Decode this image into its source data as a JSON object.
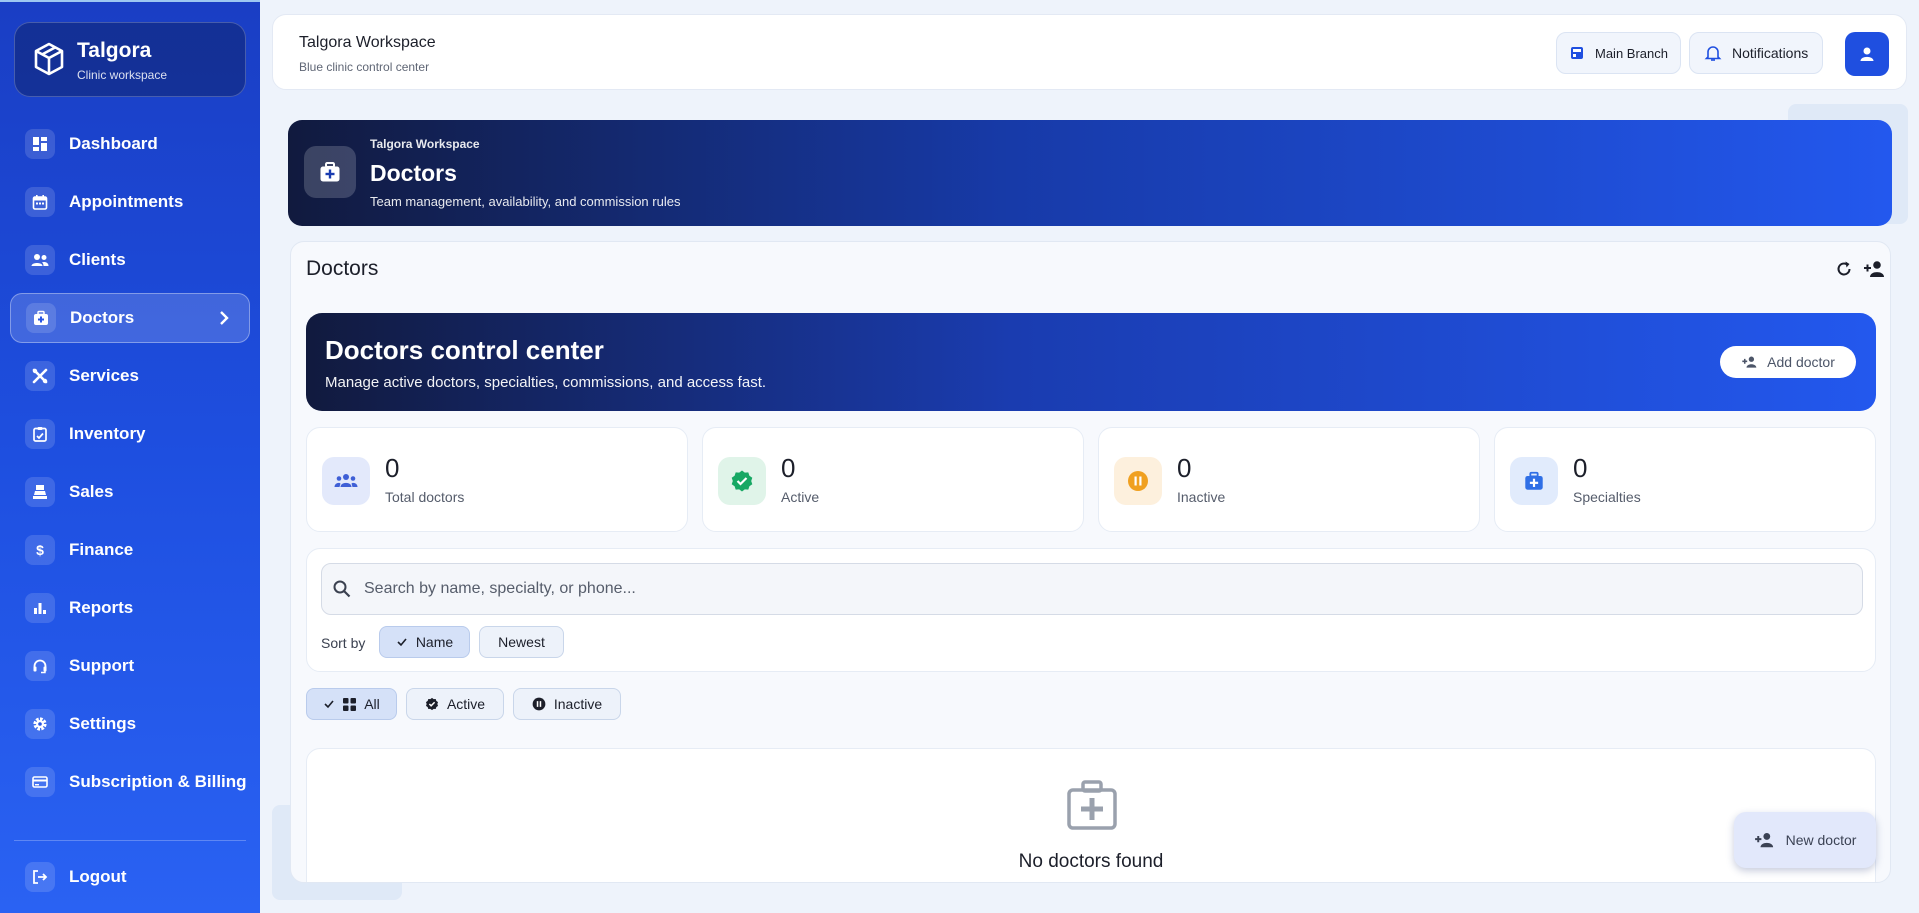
{
  "brand": {
    "name": "Talgora",
    "subtitle": "Clinic workspace"
  },
  "sidebar": {
    "items": [
      {
        "label": "Dashboard",
        "icon": "dashboard-icon"
      },
      {
        "label": "Appointments",
        "icon": "calendar-icon"
      },
      {
        "label": "Clients",
        "icon": "people-icon"
      },
      {
        "label": "Doctors",
        "icon": "medical-bag-icon",
        "active": true
      },
      {
        "label": "Services",
        "icon": "tools-icon"
      },
      {
        "label": "Inventory",
        "icon": "inventory-icon"
      },
      {
        "label": "Sales",
        "icon": "register-icon"
      },
      {
        "label": "Finance",
        "icon": "dollar-icon"
      },
      {
        "label": "Reports",
        "icon": "bar-chart-icon"
      },
      {
        "label": "Support",
        "icon": "headset-icon"
      },
      {
        "label": "Settings",
        "icon": "gear-icon"
      },
      {
        "label": "Subscription & Billing",
        "icon": "credit-card-icon"
      }
    ],
    "logout_label": "Logout"
  },
  "topbar": {
    "title": "Talgora Workspace",
    "subtitle": "Blue clinic control center",
    "branch_label": "Main Branch",
    "notifications_label": "Notifications"
  },
  "hero": {
    "kicker": "Talgora Workspace",
    "title": "Doctors",
    "subtitle": "Team management, availability, and commission rules"
  },
  "main": {
    "title": "Doctors",
    "control": {
      "title": "Doctors control center",
      "subtitle": "Manage active doctors, specialties, commissions, and access fast.",
      "add_label": "Add doctor"
    },
    "stats": [
      {
        "value": "0",
        "label": "Total doctors",
        "icon": "group-icon",
        "color": "#3f5fd6"
      },
      {
        "value": "0",
        "label": "Active",
        "icon": "verified-icon",
        "color": "#17a864"
      },
      {
        "value": "0",
        "label": "Inactive",
        "icon": "pause-icon",
        "color": "#f0a020"
      },
      {
        "value": "0",
        "label": "Specialties",
        "icon": "medical-bag-icon",
        "color": "#2f6fe6"
      }
    ],
    "search": {
      "placeholder": "Search by name, specialty, or phone..."
    },
    "sort": {
      "label": "Sort by",
      "options": [
        "Name",
        "Newest"
      ],
      "selected": "Name"
    },
    "filters": {
      "options": [
        "All",
        "Active",
        "Inactive"
      ],
      "selected": "All"
    },
    "empty_text": "No doctors found",
    "fab_label": "New doctor"
  },
  "colors": {
    "accent": "#1f4fe0",
    "sidebar": "#1e4fe0",
    "hero_dark": "#111a3e"
  }
}
